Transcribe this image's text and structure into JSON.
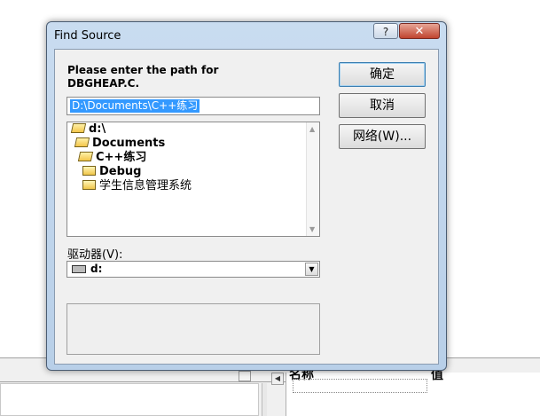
{
  "dialog": {
    "title": "Find Source",
    "help_glyph": "?",
    "close_glyph": "✕",
    "prompt_line1": "Please enter the path for",
    "prompt_line2": "DBGHEAP.C.",
    "path_value": "D:\\Documents\\C++练习",
    "tree": [
      {
        "label": "d:\\",
        "icon": "open-folder-icon"
      },
      {
        "label": "Documents",
        "icon": "open-folder-icon"
      },
      {
        "label": "C++练习",
        "icon": "open-folder-icon"
      },
      {
        "label": "Debug",
        "icon": "folder-icon"
      },
      {
        "label": "学生信息管理系统",
        "icon": "folder-icon"
      }
    ],
    "drive_label": "驱动器(V):",
    "drive_value": "d:",
    "buttons": {
      "ok": "确定",
      "cancel": "取消",
      "network": "网络(W)..."
    }
  },
  "background": {
    "col_name": "名称",
    "col_value": "值"
  },
  "colors": {
    "selection": "#3399ff",
    "close_button": "#c0442f",
    "title_bar": "#c9dcf0"
  }
}
